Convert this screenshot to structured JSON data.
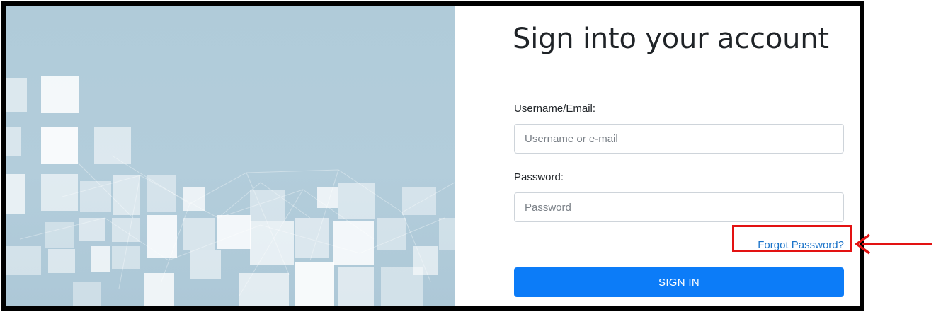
{
  "login": {
    "title": "Sign into your account",
    "username_label": "Username/Email:",
    "username_placeholder": "Username or e-mail",
    "username_value": "",
    "password_label": "Password:",
    "password_placeholder": "Password",
    "password_value": "",
    "forgot_link": "Forgot Password?",
    "signin_button": "SIGN IN"
  },
  "colors": {
    "hero_background": "#b0cbd9",
    "button": "#0c7cf8",
    "link": "#1a73c9",
    "highlight": "#e31212"
  },
  "annotations": {
    "highlight_target": "forgot-password-link",
    "arrow_icon": "arrow-left-icon"
  }
}
